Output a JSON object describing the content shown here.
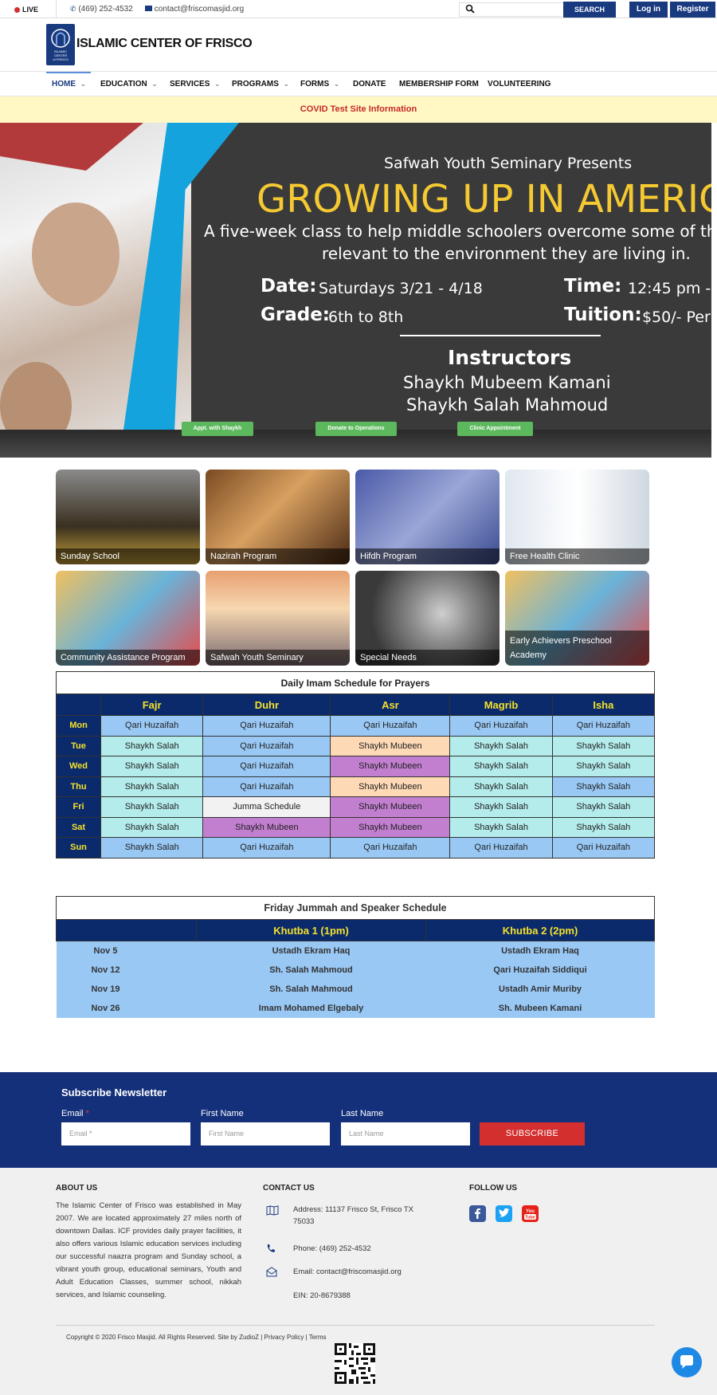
{
  "topbar": {
    "live": "LIVE",
    "phone": "(469) 252-4532",
    "email": "contact@friscomasjid.org",
    "search_placeholder": "",
    "search_label": "SEARCH",
    "login": "Log in",
    "register": "Register"
  },
  "header": {
    "site_name": "ISLAMIC CENTER OF FRISCO",
    "logo_text": "ISLAMIC CENTER of FRISCO"
  },
  "nav": {
    "items": [
      "HOME",
      "EDUCATION",
      "SERVICES",
      "PROGRAMS",
      "FORMS",
      "DONATE",
      "MEMBERSHIP FORM",
      "VOLUNTEERING"
    ]
  },
  "covid": "COVID Test Site Information",
  "hero": {
    "presents": "Safwah Youth Seminary Presents",
    "title": "GROWING UP IN AMERIC",
    "desc1": "A five-week class to help middle schoolers overcome some of the",
    "desc2": "relevant to the environment they are living in.",
    "date_label": "Date:",
    "date_value": "Saturdays 3/21 - 4/18",
    "time_label": "Time:",
    "time_value": "12:45 pm -",
    "grade_label": "Grade:",
    "grade_value": "6th to 8th",
    "tuition_label": "Tuition:",
    "tuition_value": "$50/- Per",
    "instructors_label": "Instructors",
    "instructor1": "Shaykh Mubeem Kamani",
    "instructor2": "Shaykh Salah Mahmoud",
    "buttons": [
      "Appt. with Shaykh",
      "Donate to Operations",
      "Clinic Appointment"
    ]
  },
  "programs": [
    "Sunday School",
    "Nazirah Program",
    "Hifdh Program",
    "Free Health Clinic",
    "Community Assistance Program",
    "Safwah Youth Seminary",
    "Special Needs",
    "Early Achievers Preschool Academy"
  ],
  "prayer": {
    "caption": "Daily Imam Schedule for Prayers",
    "headers": [
      "Fajr",
      "Duhr",
      "Asr",
      "Magrib",
      "Isha"
    ],
    "rows": [
      {
        "day": "Mon",
        "cells": [
          "Qari Huzaifah",
          "Qari Huzaifah",
          "Qari Huzaifah",
          "Qari Huzaifah",
          "Qari Huzaifah"
        ]
      },
      {
        "day": "Tue",
        "cells": [
          "Shaykh Salah",
          "Qari Huzaifah",
          "Shaykh Mubeen",
          "Shaykh Salah",
          "Shaykh Salah"
        ]
      },
      {
        "day": "Wed",
        "cells": [
          "Shaykh Salah",
          "Qari Huzaifah",
          "Shaykh Mubeen",
          "Shaykh Salah",
          "Shaykh Salah"
        ]
      },
      {
        "day": "Thu",
        "cells": [
          "Shaykh Salah",
          "Qari Huzaifah",
          "Shaykh Mubeen",
          "Shaykh Salah",
          "Shaykh Salah"
        ]
      },
      {
        "day": "Fri",
        "cells": [
          "Shaykh Salah",
          "Jumma Schedule",
          "Shaykh Mubeen",
          "Shaykh Salah",
          "Shaykh Salah"
        ]
      },
      {
        "day": "Sat",
        "cells": [
          "Shaykh Salah",
          "Shaykh Mubeen",
          "Shaykh Mubeen",
          "Shaykh Salah",
          "Shaykh Salah"
        ]
      },
      {
        "day": "Sun",
        "cells": [
          "Shaykh Salah",
          "Qari Huzaifah",
          "Qari Huzaifah",
          "Qari Huzaifah",
          "Qari Huzaifah"
        ]
      }
    ],
    "colors": {
      "qari": "#99c8f5",
      "salah": "#b4ecec",
      "mubeen_orange": "#fdd9b5",
      "mubeen_purple": "#c27fd0",
      "jumma": "#f2f2f2"
    }
  },
  "jummah": {
    "caption": "Friday Jummah and Speaker Schedule",
    "headers": [
      "",
      "Khutba 1 (1pm)",
      "Khutba 2 (2pm)"
    ],
    "rows": [
      {
        "date": "Nov 5",
        "k1": "Ustadh Ekram Haq",
        "k2": "Ustadh Ekram Haq"
      },
      {
        "date": "Nov 12",
        "k1": "Sh. Salah Mahmoud",
        "k2": "Qari Huzaifah Siddiqui"
      },
      {
        "date": "Nov 19",
        "k1": "Sh. Salah Mahmoud",
        "k2": "Ustadh Amir Muriby"
      },
      {
        "date": "Nov 26",
        "k1": "Imam Mohamed Elgebaly",
        "k2": "Sh. Mubeen Kamani"
      }
    ]
  },
  "newsletter": {
    "title": "Subscribe Newsletter",
    "email_label": "Email",
    "required_mark": "*",
    "email_placeholder": "Email *",
    "first_label": "First Name",
    "first_placeholder": "First Name",
    "last_label": "Last Name",
    "last_placeholder": "Last Name",
    "button": "SUBSCRIBE"
  },
  "footer": {
    "about_head": "ABOUT US",
    "about_text": "The Islamic Center of Frisco was established in May 2007. We are located approximately 27 miles north of downtown Dallas. ICF provides daily prayer facilities, it also offers various Islamic education services including our successful naazra program and Sunday school, a vibrant youth group, educational seminars, Youth and Adult Education Classes, summer school, nikkah services, and Islamic counseling.",
    "contact_head": "CONTACT US",
    "address": "Address: 11137 Frisco St, Frisco TX 75033",
    "phone": "Phone: (469) 252-4532",
    "email": "Email: contact@friscomasjid.org",
    "ein": "EIN: 20-8679388",
    "follow_head": "FOLLOW US",
    "copyright_prefix": "Copyright © 2020 Frisco Masjid. All Rights Reserved. Site by ",
    "zudioz": "ZudioZ",
    "sep1": " | ",
    "privacy": "Privacy Policy",
    "sep2": " | ",
    "terms": "Terms",
    "social_colors": {
      "facebook": "#3b5998",
      "twitter": "#1da1f2",
      "youtube": "#e62117"
    },
    "youtube_label": "You Tube"
  }
}
